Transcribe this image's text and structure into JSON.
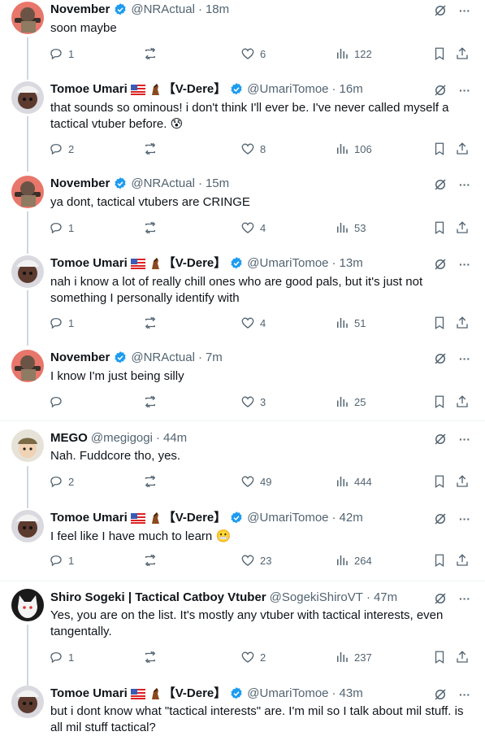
{
  "posts": [
    {
      "name": "November",
      "handle": "@NRActual",
      "time": "18m",
      "text": "soon maybe",
      "flag": false,
      "tag": "",
      "verified": true,
      "replies": "1",
      "retweets": "",
      "likes": "6",
      "views": "122"
    },
    {
      "name": "Tomoe Umari",
      "handle": "@UmariTomoe",
      "time": "16m",
      "text": "that sounds so ominous! i don't think I'll ever be. I've never called myself a tactical vtuber before. 😰",
      "flag": true,
      "tag": "【V-Dere】",
      "verified": true,
      "replies": "2",
      "retweets": "",
      "likes": "8",
      "views": "106"
    },
    {
      "name": "November",
      "handle": "@NRActual",
      "time": "15m",
      "text": "ya dont, tactical vtubers are CRINGE",
      "flag": false,
      "tag": "",
      "verified": true,
      "replies": "1",
      "retweets": "",
      "likes": "4",
      "views": "53"
    },
    {
      "name": "Tomoe Umari",
      "handle": "@UmariTomoe",
      "time": "13m",
      "text": "nah i know a lot of really chill ones who are good pals, but it's just not something I personally identify with",
      "flag": true,
      "tag": "【V-Dere】",
      "verified": true,
      "replies": "1",
      "retweets": "",
      "likes": "4",
      "views": "51"
    },
    {
      "name": "November",
      "handle": "@NRActual",
      "time": "7m",
      "text": "I know I'm just being silly",
      "flag": false,
      "tag": "",
      "verified": true,
      "replies": "",
      "retweets": "",
      "likes": "3",
      "views": "25"
    },
    {
      "name": "MEGO",
      "handle": "@megigogi",
      "time": "44m",
      "text": "Nah. Fuddcore tho, yes.",
      "flag": false,
      "tag": "",
      "verified": false,
      "replies": "2",
      "retweets": "",
      "likes": "49",
      "views": "444"
    },
    {
      "name": "Tomoe Umari",
      "handle": "@UmariTomoe",
      "time": "42m",
      "text": "I feel like I have much to learn 😬",
      "flag": true,
      "tag": "【V-Dere】",
      "verified": true,
      "replies": "1",
      "retweets": "",
      "likes": "23",
      "views": "264"
    },
    {
      "name": "Shiro Sogeki | Tactical Catboy Vtuber",
      "handle": "@SogekiShiroVT",
      "time": "47m",
      "text": "Yes, you are on the list. It's mostly any vtuber with tactical interests, even tangentally.",
      "flag": false,
      "tag": "",
      "verified": false,
      "replies": "1",
      "retweets": "",
      "likes": "2",
      "views": "237"
    },
    {
      "name": "Tomoe Umari",
      "handle": "@UmariTomoe",
      "time": "43m",
      "text": "but i dont know what \"tactical interests\" are. I'm mil so I talk about mil stuff. is all mil stuff tactical?",
      "flag": true,
      "tag": "【V-Dere】",
      "verified": true,
      "replies": "",
      "retweets": "",
      "likes": "",
      "views": ""
    }
  ],
  "ui": {
    "dot": "·",
    "more": "···"
  },
  "colors": {
    "accent": "#1d9bf0",
    "muted": "#536471",
    "text": "#0f1419",
    "line": "#cfd9de"
  }
}
